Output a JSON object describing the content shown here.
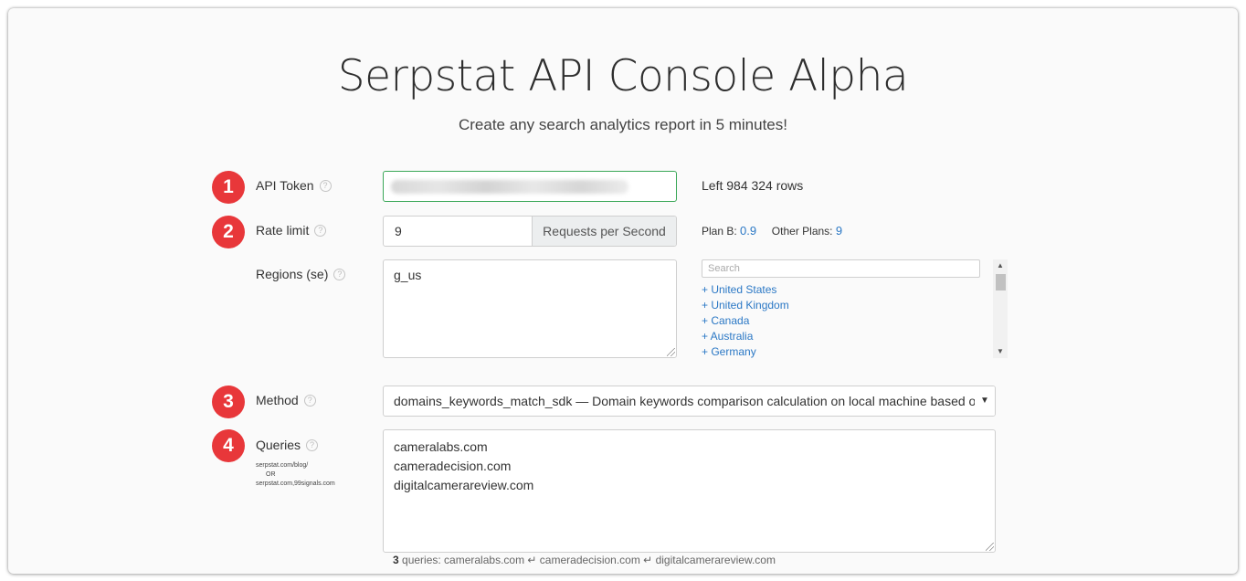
{
  "header": {
    "title": "Serpstat API Console Alpha",
    "subtitle": "Create any search analytics report in 5 minutes!"
  },
  "steps": [
    "1",
    "2",
    "3",
    "4"
  ],
  "api_token": {
    "label": "API Token",
    "rows_left": "Left 984 324 rows"
  },
  "rate_limit": {
    "label": "Rate limit",
    "value": "9",
    "addon": "Requests per Second",
    "plan_b_label": "Plan B:",
    "plan_b_value": "0.9",
    "other_label": "Other Plans:",
    "other_value": "9"
  },
  "regions": {
    "label": "Regions (se)",
    "value": "g_us",
    "search_placeholder": "Search",
    "items": [
      "+ United States",
      "+ United Kingdom",
      "+ Canada",
      "+ Australia",
      "+ Germany"
    ]
  },
  "method": {
    "label": "Method",
    "selected": "domains_keywords_match_sdk — Domain keywords comparison calculation on local machine based on"
  },
  "queries": {
    "label": "Queries",
    "hint_line1": "serpstat.com/blog/",
    "hint_or": "OR",
    "hint_line2": "serpstat.com,99signals.com",
    "lines": [
      "cameralabs.com",
      "cameradecision.com",
      "digitalcamerareview.com"
    ],
    "summary_count": "3",
    "summary_text": " queries: cameralabs.com ↵ cameradecision.com ↵ digitalcamerareview.com"
  },
  "colors": {
    "badge": "#e8373a",
    "link": "#2b78c5",
    "valid_border": "#3aa757"
  }
}
